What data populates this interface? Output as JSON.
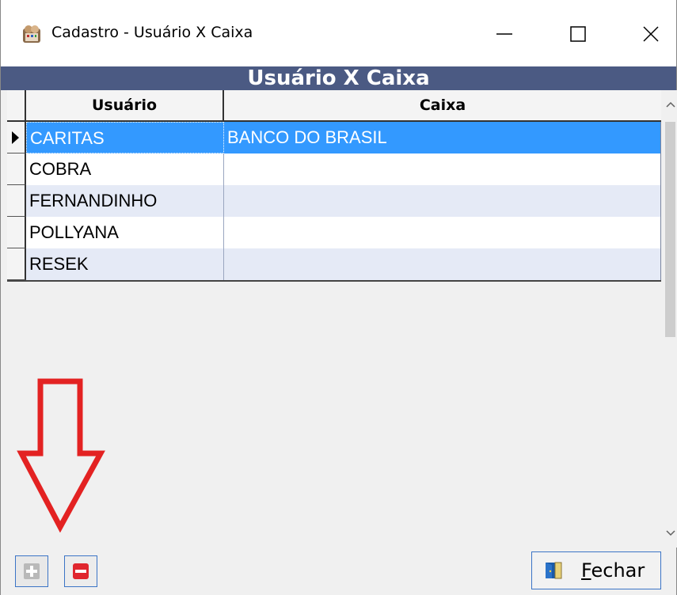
{
  "window": {
    "title": "Cadastro - Usuário X Caixa",
    "controls": [
      "minimize",
      "maximize",
      "close"
    ]
  },
  "header": {
    "title": "Usuário X Caixa",
    "background": "#4b5a83"
  },
  "grid": {
    "columns": [
      "Usuário",
      "Caixa"
    ],
    "rows": [
      {
        "usuario": "CARITAS",
        "caixa": "BANCO DO BRASIL",
        "selected": true
      },
      {
        "usuario": "COBRA",
        "caixa": "",
        "selected": false
      },
      {
        "usuario": "FERNANDINHO",
        "caixa": "",
        "selected": false
      },
      {
        "usuario": "POLLYANA",
        "caixa": "",
        "selected": false
      },
      {
        "usuario": "RESEK",
        "caixa": "",
        "selected": false
      }
    ],
    "selection_color": "#3399ff",
    "alt_row_color": "#e5eaf6"
  },
  "footer": {
    "add_icon": "plus-icon",
    "delete_icon": "minus-icon",
    "close_button": {
      "prefix": "",
      "accel": "F",
      "rest": "echar",
      "icon": "door-exit-icon"
    }
  },
  "annotation": {
    "icon": "red-down-arrow",
    "color": "#e32222"
  }
}
